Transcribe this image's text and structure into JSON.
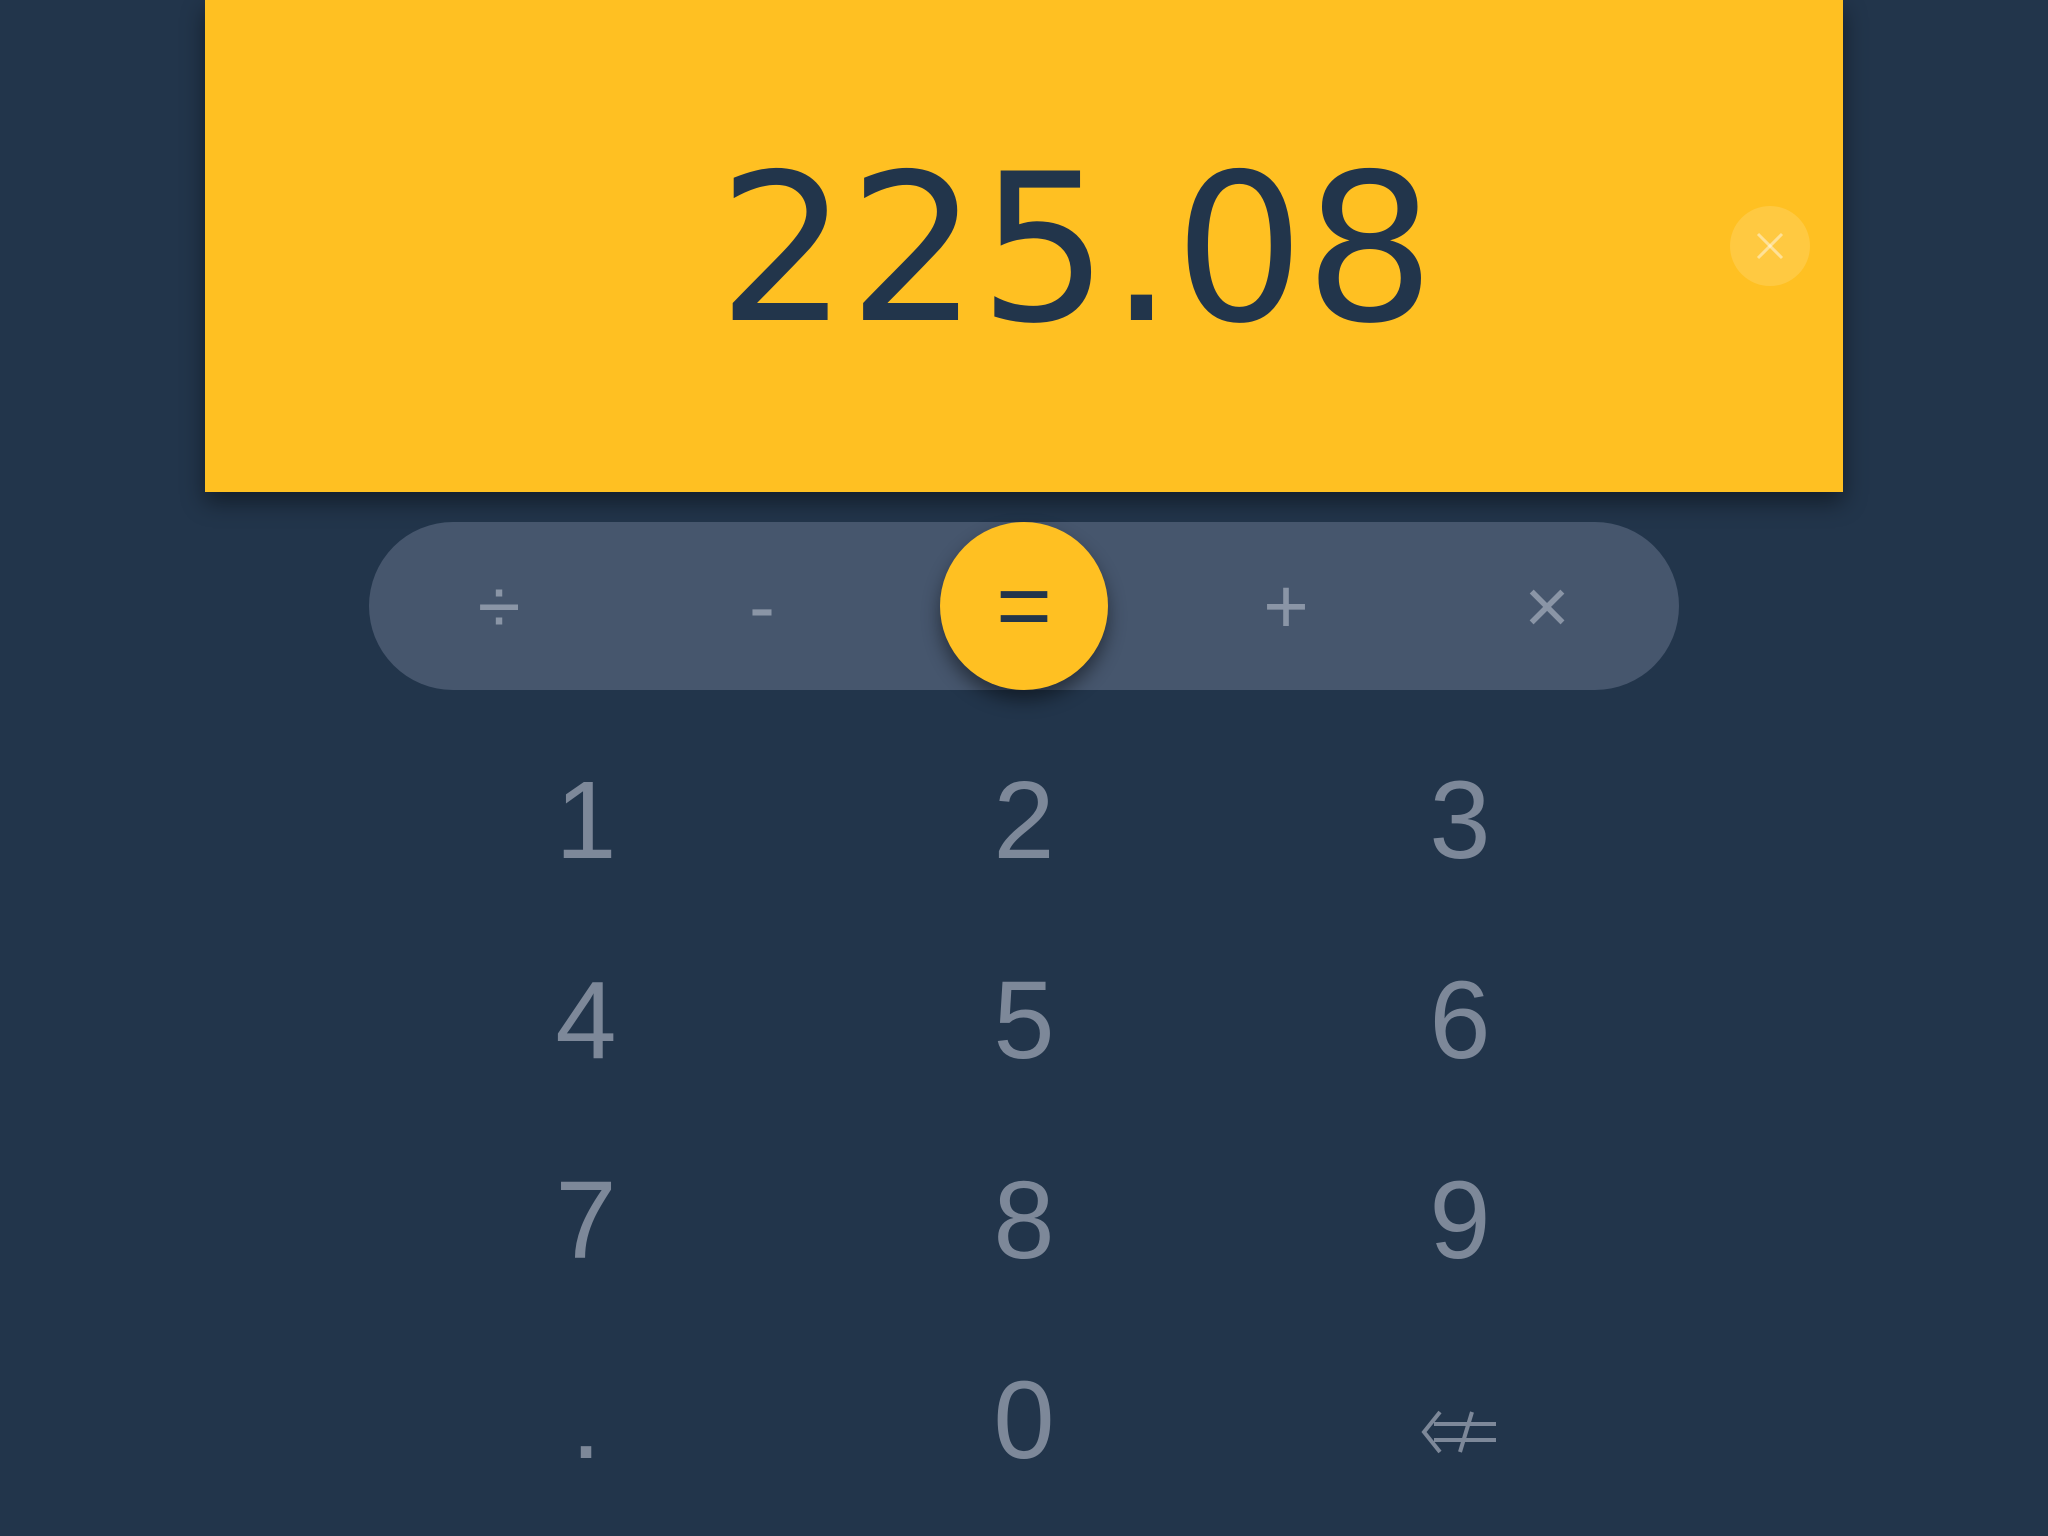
{
  "display": {
    "value": "225.08",
    "clear_icon": "close-icon"
  },
  "operators": [
    {
      "name": "divide-button",
      "label": "÷"
    },
    {
      "name": "subtract-button",
      "label": "-"
    },
    {
      "name": "equals-button",
      "label": "="
    },
    {
      "name": "add-button",
      "label": "+"
    },
    {
      "name": "multiply-button",
      "label": "×"
    }
  ],
  "keypad": {
    "keys": [
      "1",
      "2",
      "3",
      "4",
      "5",
      "6",
      "7",
      "8",
      "9",
      ".",
      "0"
    ],
    "backspace_icon": "backspace-icon"
  },
  "colors": {
    "background": "#22354b",
    "accent": "#ffc022",
    "operator_bar": "#46566d",
    "key_text": "#7d8899"
  }
}
